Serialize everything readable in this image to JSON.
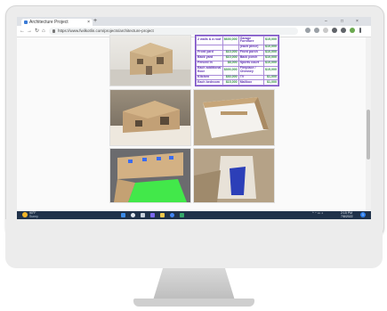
{
  "browser": {
    "tab_title": "Architecture Project",
    "tab_close": "×",
    "new_tab": "+",
    "url": "https://www.fwilkotlin.com/projects/architecture-project",
    "window_controls": [
      "–",
      "□",
      "×"
    ],
    "nav": [
      "←",
      "→",
      "↻",
      "⌂"
    ]
  },
  "cost_table": {
    "rows": [
      [
        "2 walls & a roof",
        "$600,000",
        "Garage Furniture",
        "$15,000"
      ],
      [
        "",
        "",
        "(each piece)",
        "$10,000"
      ],
      [
        "Front yard",
        "$10,000",
        "Front porch",
        "$10,000"
      ],
      [
        "Back yard",
        "$10,000",
        "Back porch",
        "$10,000"
      ],
      [
        "Fenced in",
        "$8,000",
        "Sports court",
        "$10,000"
      ],
      [
        "Each additional floor",
        "$300,000",
        "Fireplace / Chimney",
        "$15,000"
      ],
      [
        "Kitchen",
        "$30,000",
        "TV",
        "$1,000"
      ],
      [
        "Each bedroom",
        "$15,000",
        "Mailbox",
        "$1,000"
      ]
    ]
  },
  "taskbar": {
    "weather_temp": "90°F",
    "weather_desc": "Sunny",
    "time": "2:15 PM",
    "date": "7/8/2022",
    "notification_count": "1"
  },
  "colors": {
    "taskbar": "#20324a",
    "table_border": "#7a4fc6",
    "table_label": "#5b2fb0",
    "table_value": "#2b8a3e"
  }
}
